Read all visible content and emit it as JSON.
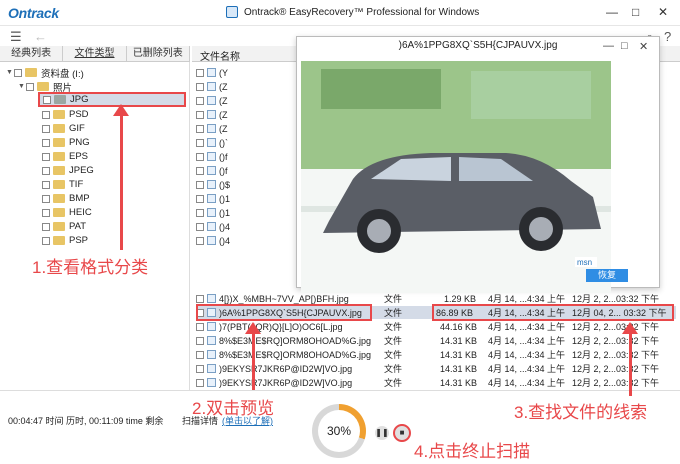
{
  "app": {
    "logo": "Ontrack",
    "title": "Ontrack® EasyRecovery™ Professional for Windows",
    "minimize": "—",
    "maximize": "□",
    "close": "✕"
  },
  "toolbar": {
    "menu_icon": "☰",
    "back_icon": "←",
    "search_icon": "⌕",
    "help_icon": "?"
  },
  "tabs": [
    "经典列表",
    "文件类型",
    "已删除列表"
  ],
  "tree": {
    "root": "资料盘 (I:)",
    "photos": "照片",
    "formats": [
      "JPG",
      "PSD",
      "GIF",
      "PNG",
      "EPS",
      "JPEG",
      "TIF",
      "BMP",
      "HEIC",
      "PAT",
      "PSP"
    ]
  },
  "file_header": "文件名称",
  "list_prefixes": [
    "(Y",
    "(Z",
    "(Z",
    "(Z",
    "(Z",
    "()`",
    "()f",
    "()f",
    "()$",
    "()1",
    "()1",
    "()4",
    "()4"
  ],
  "rows": [
    {
      "name": "4[})X_%MBH~7VV_AP[)BFH.jpg",
      "type": "文件",
      "size": "1.29 KB",
      "created": "4月 14, ...4:34 上午",
      "modified": "12月 2, 2...03:32 下午"
    },
    {
      "name": ")6A%1PPG8XQ`S5H{CJPAUVX.jpg",
      "type": "文件",
      "size": "86.89 KB",
      "created": "4月 14, ...4:34 上午",
      "modified": "12月 04, 2... 03:32 下午"
    },
    {
      "name": ")7(PBT(4QR)Q}[L]O)OC6[L.jpg",
      "type": "文件",
      "size": "44.16 KB",
      "created": "4月 14, ...4:34 上午",
      "modified": "12月 2, 2...03:32 下午"
    },
    {
      "name": "8%$E3ME$RQ]ORM8OHOAD%G.jpg",
      "type": "文件",
      "size": "14.31 KB",
      "created": "4月 14, ...4:34 上午",
      "modified": "12月 2, 2...03:32 下午"
    },
    {
      "name": "8%$E3ME$RQ]ORM8OHOAD%G.jpg",
      "type": "文件",
      "size": "14.31 KB",
      "created": "4月 14, ...4:34 上午",
      "modified": "12月 2, 2...03:32 下午"
    },
    {
      "name": ")9EKYSR7JKR6P@ID2W]VO.jpg",
      "type": "文件",
      "size": "14.31 KB",
      "created": "4月 14, ...4:34 上午",
      "modified": "12月 2, 2...03:32 下午"
    },
    {
      "name": ")9EKYSR7JKR6P@ID2W]VO.jpg",
      "type": "文件",
      "size": "14.31 KB",
      "created": "4月 14, ...4:34 上午",
      "modified": "12月 2, 2...03:32 下午"
    }
  ],
  "preview": {
    "title": ")6A%1PPG8XQ`S5H{CJPAUVX.jpg",
    "restore": "恢复",
    "watermark": "msn"
  },
  "status": {
    "time": "00:04:47 时间 历时, 00:11:09 time 剩余",
    "scan_detail_label": "扫描详情",
    "scan_detail_link": "(单击以了解)",
    "progress_text": "30%",
    "progress": 0.3,
    "pause_icon": "❚❚",
    "stop_icon": "■"
  },
  "annotations": {
    "a1": "1.查看格式分类",
    "a2": "2.双击预览",
    "a3": "3.查找文件的线索",
    "a4": "4.点击终止扫描",
    "color": "#e8484a"
  }
}
